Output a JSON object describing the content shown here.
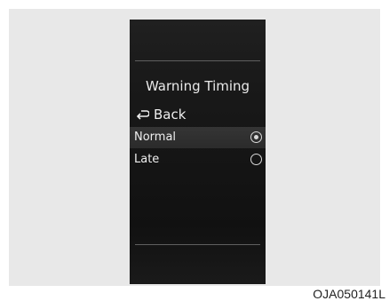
{
  "screen": {
    "title": "Warning Timing",
    "back_label": "Back",
    "back_icon": "return-arrow-icon",
    "radio_icon": "radio-icon",
    "options": [
      {
        "label": "Normal",
        "selected": true
      },
      {
        "label": "Late",
        "selected": false
      }
    ]
  },
  "caption": "OJA050141L",
  "colors": {
    "screen_background": "#191919",
    "text": "#efefef",
    "highlight": "#333333",
    "panel": "#e8e8e8"
  }
}
